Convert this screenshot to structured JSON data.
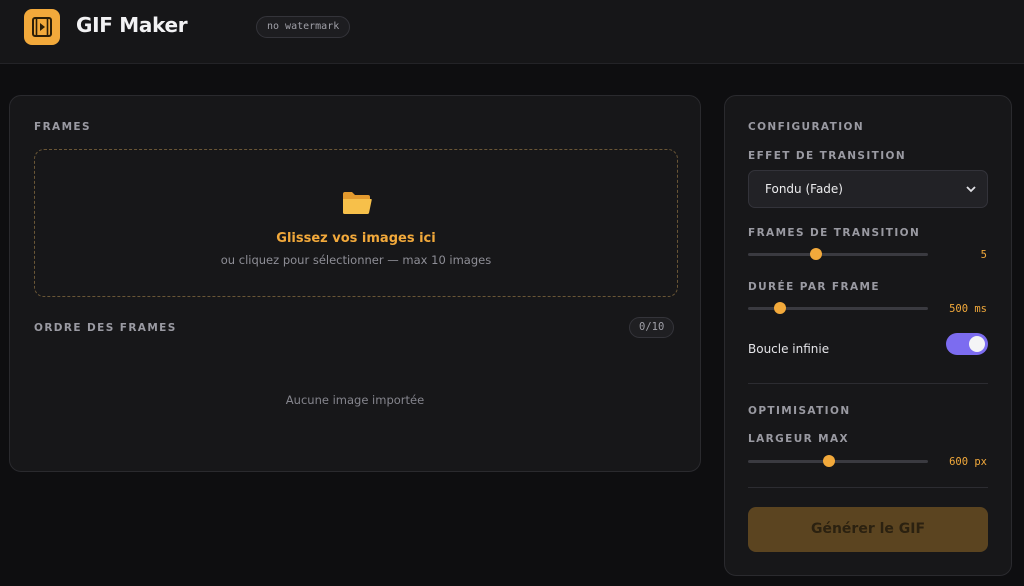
{
  "app": {
    "title": "GIF Maker",
    "badge": "no watermark",
    "accent_color": "#f2a93b",
    "toggle_color": "#7c6cf0"
  },
  "frames_panel": {
    "section_label": "FRAMES",
    "dropzone": {
      "icon": "folder-icon",
      "title": "Glissez vos images ici",
      "subtitle": "ou cliquez pour sélectionner — max 10 images"
    },
    "order_label": "ORDRE DES FRAMES",
    "counter": "0/10",
    "empty_message": "Aucune image importée"
  },
  "config": {
    "section_label": "CONFIGURATION",
    "transition_effect": {
      "label": "EFFET DE TRANSITION",
      "selected": "Fondu (Fade)"
    },
    "transition_frames": {
      "label": "FRAMES DE TRANSITION",
      "value": "5",
      "level": 0.38
    },
    "frame_duration": {
      "label": "DURÉE PAR FRAME",
      "value": "500 ms",
      "level": 0.18
    },
    "loop": {
      "label": "Boucle infinie",
      "enabled": true
    },
    "optimization_label": "OPTIMISATION",
    "max_width": {
      "label": "LARGEUR MAX",
      "value": "600 px",
      "level": 0.45
    },
    "generate_button": "Générer le GIF"
  }
}
